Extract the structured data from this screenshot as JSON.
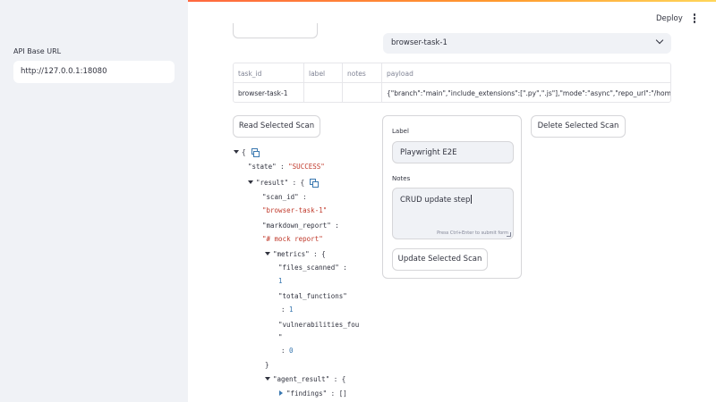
{
  "sidebar": {
    "api_label": "API Base URL",
    "api_value": "http://127.0.0.1:18080"
  },
  "header": {
    "deploy_label": "Deploy"
  },
  "scan_select": {
    "selected": "browser-task-1"
  },
  "table": {
    "headers": [
      "task_id",
      "label",
      "notes",
      "payload"
    ],
    "rows": [
      [
        "browser-task-1",
        "",
        "",
        "{\"branch\":\"main\",\"include_extensions\":[\".py\",\".js\"],\"mode\":\"async\",\"repo_url\":\"/home/run"
      ]
    ]
  },
  "buttons": {
    "read": "Read Selected Scan",
    "delete": "Delete Selected Scan",
    "update": "Update Selected Scan"
  },
  "form": {
    "label_title": "Label",
    "label_value": "Playwright E2E",
    "notes_title": "Notes",
    "notes_value": "CRUD update step",
    "notes_hint": "Press Ctrl+Enter to submit form"
  },
  "json_view": {
    "open_brace": "{",
    "close_brace": "}",
    "state_key": "\"state\"",
    "state_value": "\"SUCCESS\"",
    "result_key": "\"result\"",
    "scan_id_key": "\"scan_id\"",
    "scan_id_value": "\"browser-task-1\"",
    "markdown_key": "\"markdown_report\"",
    "markdown_value": "\"# mock report\"",
    "metrics_key": "\"metrics\"",
    "files_key": "\"files_scanned\"",
    "files_value": "1",
    "funcs_key": "\"total_functions\"",
    "funcs_value": "1",
    "vulns_key_a": "\"vulnerabilities_fou",
    "vulns_key_b": "\"",
    "vulns_value": "0",
    "agent_key": "\"agent_result\"",
    "findings_key": "\"findings\"",
    "findings_value": "[]"
  }
}
